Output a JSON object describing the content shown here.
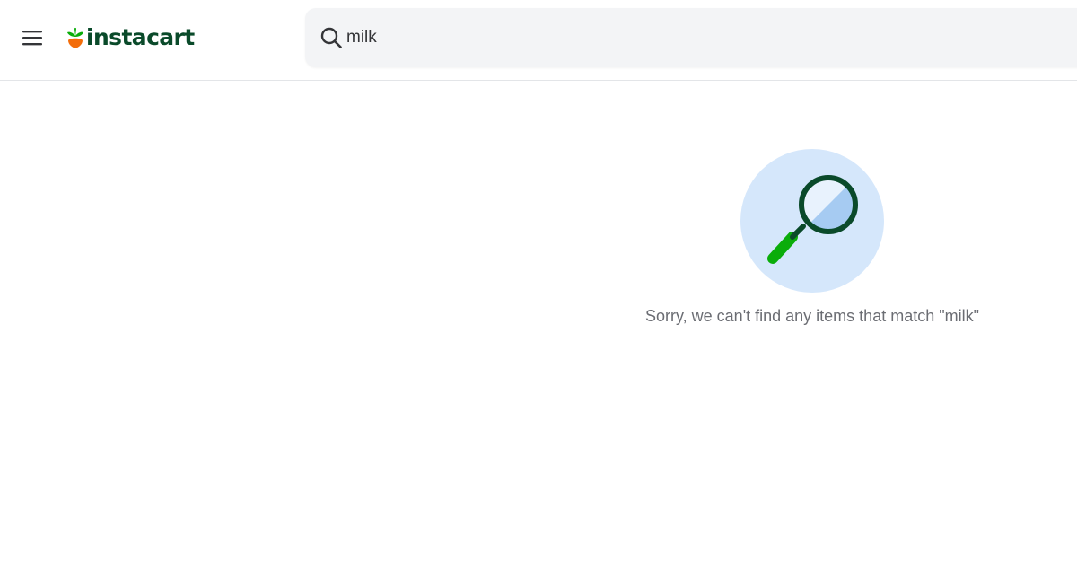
{
  "header": {
    "menu_icon": "hamburger-menu-icon",
    "logo_icon": "carrot-icon",
    "logo_text": "instacart",
    "brand_color": "#0a4a2a",
    "carrot_color": "#f36d0a",
    "carrot_leaf_color": "#0aad0a"
  },
  "search": {
    "icon": "search-icon",
    "value": "milk"
  },
  "empty_state": {
    "illustration_icon": "magnifying-glass-icon",
    "message": "Sorry, we can't find any items that match \"milk\""
  },
  "colors": {
    "search_bg": "#f3f4f6",
    "illustration_bg": "#d5e7fb",
    "magnifier_frame": "#0a4a2a",
    "magnifier_handle": "#0aad0a",
    "message_text": "#6b6d73"
  }
}
